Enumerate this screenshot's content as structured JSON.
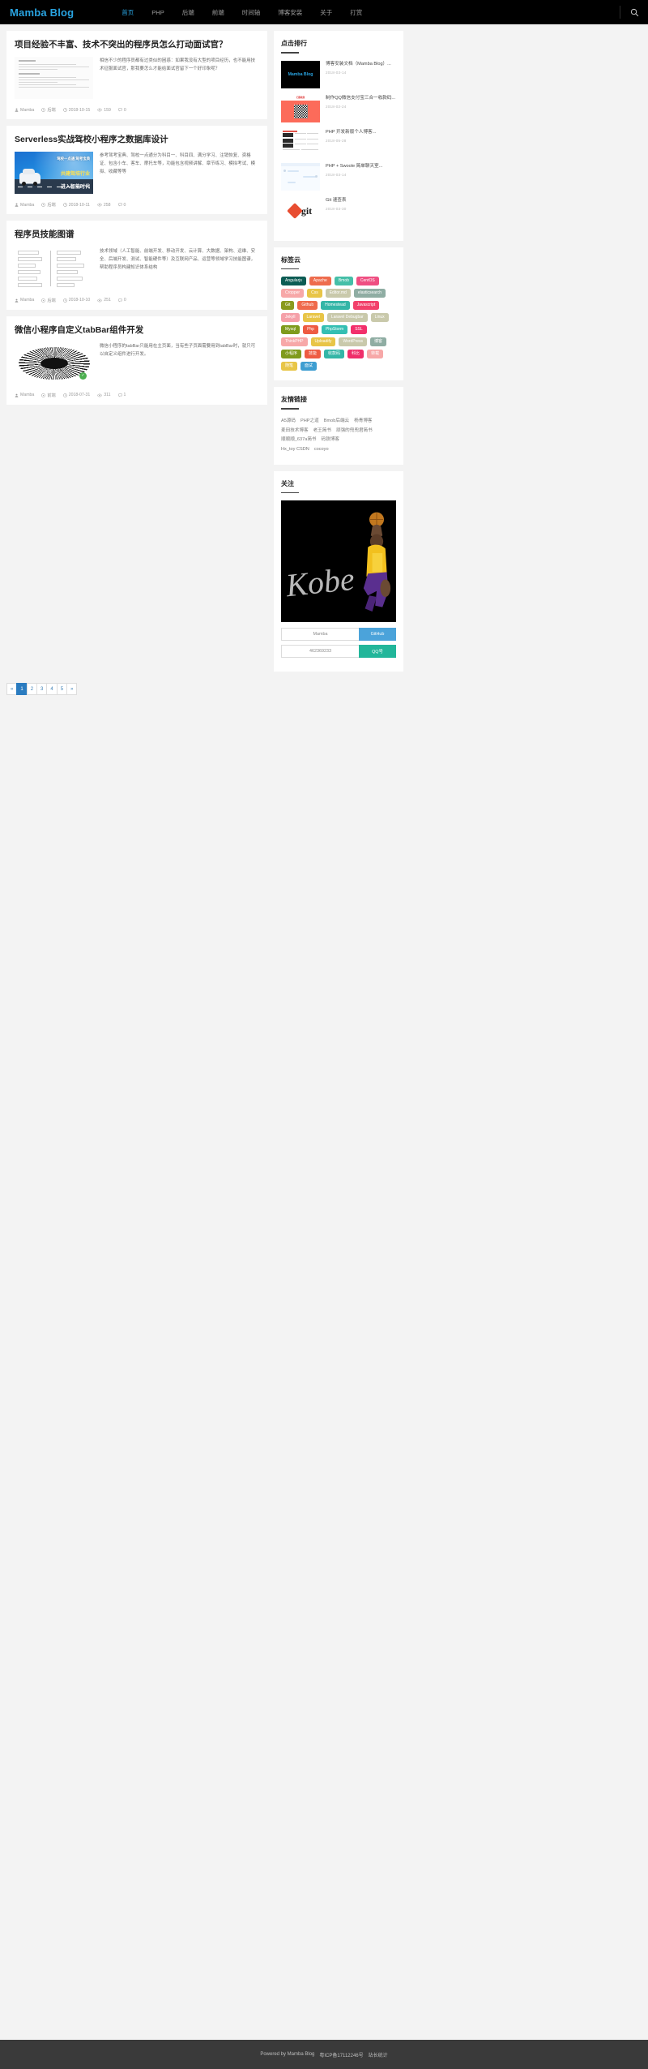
{
  "site": {
    "brand": "Mamba Blog"
  },
  "nav": {
    "items": [
      {
        "label": "首页",
        "active": true
      },
      {
        "label": "PHP",
        "active": false
      },
      {
        "label": "后端",
        "active": false
      },
      {
        "label": "前端",
        "active": false
      },
      {
        "label": "时间轴",
        "active": false
      },
      {
        "label": "博客安装",
        "active": false
      },
      {
        "label": "关于",
        "active": false
      },
      {
        "label": "打赏",
        "active": false
      }
    ],
    "search_icon": "search-icon"
  },
  "posts": [
    {
      "title": "项目经验不丰富、技术不突出的程序员怎么打动面试官？",
      "excerpt": "相信不少的程序员都有过类似的困惑：如果我没有大型的项目经历，也不能用技术征服面试官，那我要怎么才能给面试官留下一个好印象呢？",
      "author": "Mamba",
      "category": "后端",
      "date": "2018-10-15",
      "views": "159",
      "comments": "0",
      "thumb": "doc-screenshot"
    },
    {
      "title": "Serverless实战驾校小程序之数据库设计",
      "excerpt": "参考驾考宝典、驾校一点通分为科目一、科目四、满分学习、注销恢复、资格证、包含小车、客车、摩托车等，功能包含视频讲解、章节练习、模拟考试、模拟、收藏等等",
      "author": "Mamba",
      "category": "后端",
      "date": "2018-10-11",
      "views": "258",
      "comments": "0",
      "thumb": "driving-school-banner"
    },
    {
      "title": "程序员技能图谱",
      "excerpt": "技术领域（人工智能、前端开发、移动开发、云计算、大数据、架构、运维、安全、后端开发、测试、智能硬件等）及互联网产品、运营等领域学习技能图谱，帮助程序员构建知识体系结构",
      "author": "Mamba",
      "category": "后端",
      "date": "2018-10-10",
      "views": "251",
      "comments": "0",
      "thumb": "skill-mindmap"
    },
    {
      "title": "微信小程序自定义tabBar组件开发",
      "excerpt": "微信小程序的tabBar只能用在主页面，当有些子页面需要用到tabBar时，就只可以自定义组件进行开发。",
      "author": "Mamba",
      "category": "前端",
      "date": "2018-07-31",
      "views": "311",
      "comments": "1",
      "thumb": "tabbar-burst"
    }
  ],
  "sidebar": {
    "ranking": {
      "title": "点击排行",
      "items": [
        {
          "name": "博客安装文档（Mamba Blog）...",
          "date": "2018-03-14",
          "thumb": "mamba-logo"
        },
        {
          "name": "制作QQ微信支付宝三合一收款码...",
          "date": "2018-02-24",
          "thumb": "payment-qr"
        },
        {
          "name": "PHP 开发新版个人博客...",
          "date": "2018-05-28",
          "thumb": "site-screenshot"
        },
        {
          "name": "PHP + Swoole 简单聊天室...",
          "date": "2018-03-14",
          "thumb": "chat-screenshot"
        },
        {
          "name": "Git 速查表",
          "date": "2018-03-30",
          "thumb": "git-logo"
        }
      ]
    },
    "tags": {
      "title": "标签云",
      "items": [
        {
          "label": "Angularjs",
          "color": "#0d5c54"
        },
        {
          "label": "Apache",
          "color": "#ee6c4d"
        },
        {
          "label": "Bmob",
          "color": "#45bfa8"
        },
        {
          "label": "CentOS",
          "color": "#ef4f82"
        },
        {
          "label": "Cropper",
          "color": "#f7a8a8"
        },
        {
          "label": "Css",
          "color": "#e8c547"
        },
        {
          "label": "Editor.md",
          "color": "#c9c9ab"
        },
        {
          "label": "elasticsearch",
          "color": "#8fada3"
        },
        {
          "label": "Git",
          "color": "#8a9a1e"
        },
        {
          "label": "Github",
          "color": "#ef6a4c"
        },
        {
          "label": "Homestead",
          "color": "#34b6a7"
        },
        {
          "label": "Javascript",
          "color": "#f2416b"
        },
        {
          "label": "Jekyll",
          "color": "#f5a0a8"
        },
        {
          "label": "Laravel",
          "color": "#e8c547"
        },
        {
          "label": "Laravel Debugbar",
          "color": "#c9c9ab"
        },
        {
          "label": "Linux",
          "color": "#c9c9ab"
        },
        {
          "label": "Mysql",
          "color": "#7f9b1c"
        },
        {
          "label": "Php",
          "color": "#ee5b42"
        },
        {
          "label": "PhpStorm",
          "color": "#34bfb3"
        },
        {
          "label": "SSL",
          "color": "#f2306b"
        },
        {
          "label": "ThinkPHP",
          "color": "#f7a8a8"
        },
        {
          "label": "Uploadify",
          "color": "#e8c547"
        },
        {
          "label": "WordPress",
          "color": "#c9c9ab"
        },
        {
          "label": "博客",
          "color": "#8fada3"
        },
        {
          "label": "小程序",
          "color": "#7f9b1c"
        },
        {
          "label": "技能",
          "color": "#ee5b42"
        },
        {
          "label": "收款码",
          "color": "#34b6a7"
        },
        {
          "label": "科比",
          "color": "#ef2e6a"
        },
        {
          "label": "转载",
          "color": "#f7a8a8"
        },
        {
          "label": "随笔",
          "color": "#e8c547"
        },
        {
          "label": "面试",
          "color": "#3e9ed1"
        }
      ]
    },
    "friend_links": {
      "title": "友情链接",
      "items": [
        "A5源码",
        "PHP之道",
        "Bmob后端云",
        "杨青博客",
        "麦田技术博客",
        "老王简书",
        "顽强的兜兜君简书",
        "顺顺顺_637a简书",
        "码铁博客",
        "Hx_toy CSDN",
        "cocoyo"
      ]
    },
    "follow": {
      "title": "关注",
      "image_name": "kobe-photo",
      "rows": [
        {
          "value": "Mamba",
          "button": "GitHub",
          "color": "#4ba3da"
        },
        {
          "value": "462369233",
          "button": "QQ号",
          "color": "#22b69a"
        }
      ]
    }
  },
  "pagination": {
    "prev": "«",
    "pages": [
      "1",
      "2",
      "3",
      "4",
      "5"
    ],
    "next": "»",
    "current": "1"
  },
  "footer": {
    "powered": "Powered by Mamba Blog",
    "icp": "粤ICP备17112246号",
    "stats": "站长统计"
  }
}
